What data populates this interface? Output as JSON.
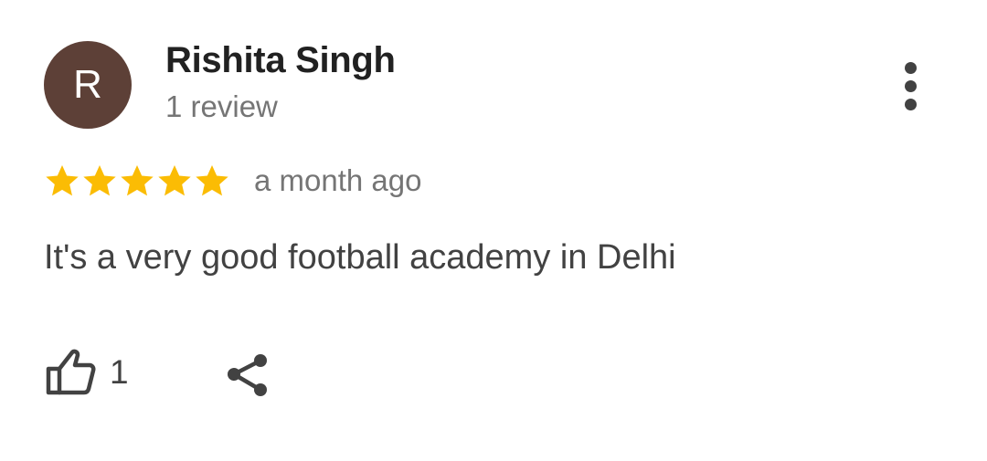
{
  "reviewer": {
    "avatar_initial": "R",
    "avatar_color": "#5d4037",
    "name": "Rishita Singh",
    "review_count": "1 review"
  },
  "rating": {
    "stars": 5,
    "max_stars": 5,
    "star_color": "#fbbc04"
  },
  "review": {
    "date": "a month ago",
    "text": "It's a very good football academy in Delhi"
  },
  "actions": {
    "like_count": "1",
    "like_icon": "thumb-up-outline-icon",
    "share_icon": "share-icon",
    "more_icon": "more-vert-icon"
  }
}
